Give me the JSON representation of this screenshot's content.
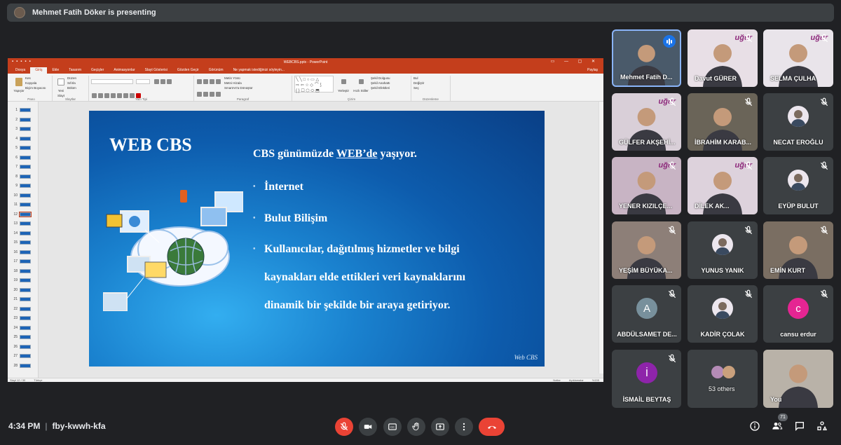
{
  "presenting_bar": {
    "text": "Mehmet Fatih Döker is presenting"
  },
  "powerpoint": {
    "window_title": "WEBCBS.pptx - PowerPoint",
    "tabs": [
      "Dosya",
      "Giriş",
      "Ekle",
      "Tasarım",
      "Geçişler",
      "Animasyonlar",
      "Slayt Gösterisi",
      "Gözden Geçir",
      "Görünüm",
      "Ne yapmak istediğinizi söyleyin..."
    ],
    "share": "Paylaş",
    "ribbon_groups": [
      "Pano",
      "Slaytlar",
      "Yazı Tipi",
      "Paragraf",
      "Çizim",
      "Düzenleme"
    ],
    "ribbon_items": {
      "cut": "Kes",
      "copy": "Kopyala",
      "format_painter": "Biçim Boyacısı",
      "paste": "Yapıştır",
      "new_slide": "Yeni Slayt",
      "layout": "Düzen",
      "reset": "Sıfırla",
      "section": "Bölüm",
      "text_direction": "Metin Yönü",
      "align_text": "Metni Hizala",
      "smartart": "SmartArt'a Dönüştür",
      "arrange": "Yerleştir",
      "quick_styles": "Hızlı Stiller",
      "shape_fill": "Şekil Dolgusu",
      "shape_outline": "Şekil Anahattı",
      "shape_effects": "Şekil Efektleri",
      "find": "Bul",
      "replace": "Değiştir",
      "select": "Seç"
    },
    "status": {
      "slide": "Slayt 12 / 30",
      "language": "Türkçe",
      "notes": "Notlar",
      "comments": "Açıklamalar",
      "zoom": "%155"
    },
    "thumbnails": [
      "1",
      "2",
      "3",
      "4",
      "5",
      "6",
      "7",
      "8",
      "9",
      "10",
      "11",
      "12",
      "13",
      "14",
      "15",
      "16",
      "17",
      "18",
      "19",
      "20",
      "21",
      "22",
      "23",
      "24",
      "25",
      "26",
      "27",
      "28"
    ],
    "active_thumbnail": "12"
  },
  "slide": {
    "title": "WEB CBS",
    "lead_pre": "CBS günümüzde ",
    "lead_u": "WEB’de",
    "lead_post": " yaşıyor.",
    "bullets": [
      "İnternet",
      "Bulut Bilişim"
    ],
    "bullet3_lines": [
      "Kullanıcılar, dağıtılmış hizmetler ve bilgi",
      "kaynakları elde ettikleri veri kaynaklarını",
      "dinamik bir şekilde bir araya getiriyor."
    ],
    "footer": "Web CBS"
  },
  "participants": [
    {
      "name": "Mehmet Fatih D...",
      "kind": "video",
      "speaking": true
    },
    {
      "name": "Davut GÜRER",
      "kind": "video"
    },
    {
      "name": "SELMA ÇULHA",
      "kind": "video"
    },
    {
      "name": "GÜLFER AKŞEHİ...",
      "kind": "video"
    },
    {
      "name": "İBRAHİM KARAB...",
      "kind": "video"
    },
    {
      "name": "NECAT EROĞLU",
      "kind": "avatar"
    },
    {
      "name": "YENER KIZILÇE...",
      "kind": "video"
    },
    {
      "name": "DİLEK AK...",
      "kind": "video"
    },
    {
      "name": "EYÜP BULUT",
      "kind": "avatar"
    },
    {
      "name": "YEŞİM BÜYÜKA...",
      "kind": "video"
    },
    {
      "name": "YUNUS YANIK",
      "kind": "avatar"
    },
    {
      "name": "EMİN KURT",
      "kind": "video"
    },
    {
      "name": "ABDÜLSAMET DE...",
      "kind": "letter",
      "letter": "A",
      "color": "#78909c"
    },
    {
      "name": "KADİR ÇOLAK",
      "kind": "avatar"
    },
    {
      "name": "cansu erdur",
      "kind": "letter",
      "letter": "c",
      "color": "#e52592"
    },
    {
      "name": "İSMAİL BEYTAŞ",
      "kind": "letter",
      "letter": "İ",
      "color": "#8e24aa"
    },
    {
      "name": "53 others",
      "kind": "others"
    },
    {
      "name": "You",
      "kind": "video"
    }
  ],
  "brand_text": "uğur",
  "bottom_bar": {
    "time": "4:34 PM",
    "meeting_code": "fby-kwwh-kfa",
    "people_count": "71"
  },
  "colors": {
    "accent_red": "#ea4335",
    "ppt_red": "#c43e1c",
    "tile_bg": "#3c4043",
    "bg": "#202124",
    "speaking_blue": "#1a73e8"
  }
}
